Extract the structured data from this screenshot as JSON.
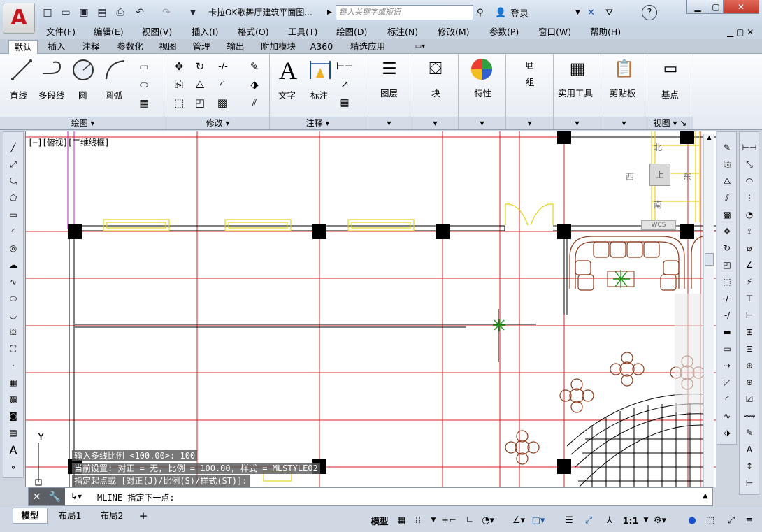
{
  "titlebar": {
    "title": "卡拉OK歌舞厅建筑平面图...",
    "search_placeholder": "键入关键字或短语",
    "login": "登录",
    "help": "?"
  },
  "menubar": [
    "文件(F)",
    "编辑(E)",
    "视图(V)",
    "插入(I)",
    "格式(O)",
    "工具(T)",
    "绘图(D)",
    "标注(N)",
    "修改(M)",
    "参数(P)",
    "窗口(W)",
    "帮助(H)"
  ],
  "ribbon_tabs": [
    "默认",
    "插入",
    "注释",
    "参数化",
    "视图",
    "管理",
    "输出",
    "附加模块",
    "A360",
    "精选应用"
  ],
  "ribbon": {
    "draw": {
      "title": "绘图",
      "line": "直线",
      "polyline": "多段线",
      "circle": "圆",
      "arc": "圆弧"
    },
    "modify": {
      "title": "修改"
    },
    "annotation": {
      "title": "注释",
      "text": "文字",
      "dimension": "标注"
    },
    "layers": {
      "label": "图层"
    },
    "block": {
      "label": "块"
    },
    "properties": {
      "label": "特性"
    },
    "group": {
      "label": "组"
    },
    "utilities": {
      "label": "实用工具"
    },
    "clipboard": {
      "label": "剪贴板"
    },
    "view": {
      "title": "视图",
      "base": "基点"
    }
  },
  "viewport": {
    "label": "[−][俯视][二维线框]",
    "compass": {
      "north": "北",
      "south": "南",
      "east": "东",
      "west": "西",
      "top": "上",
      "wcs": "WCS"
    },
    "ucs_y": "Y"
  },
  "command": {
    "history": [
      "输入多线比例 <100.00>:  100",
      "当前设置: 对正 = 无, 比例 = 100.00, 样式 = MLSTYLE02",
      "指定起点或 [对正(J)/比例(S)/样式(ST)]:"
    ],
    "prompt": "MLINE 指定下一点:"
  },
  "layout_tabs": [
    "模型",
    "布局1",
    "布局2"
  ],
  "status": {
    "model": "模型",
    "scale": "1:1"
  },
  "colors": {
    "accent": "#c4161c",
    "grid_red": "#d42020",
    "yellow": "#e6d21a",
    "brown": "#8b3a1a",
    "green": "#1a9a1a",
    "magenta": "#c020c0"
  }
}
